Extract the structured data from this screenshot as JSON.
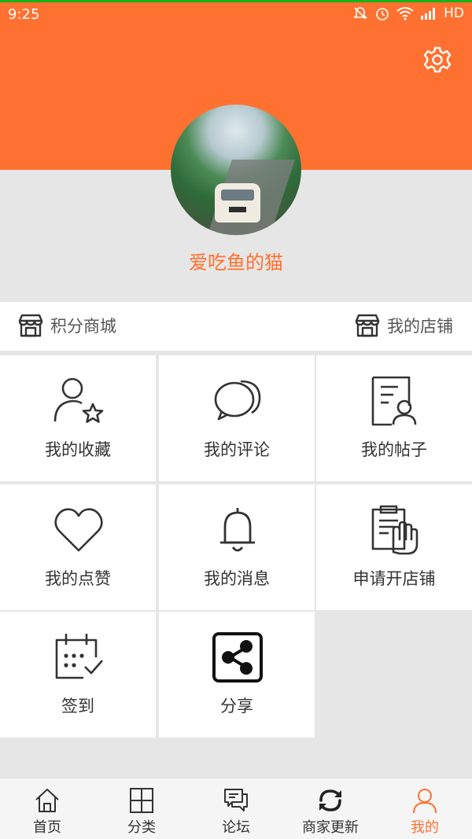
{
  "status_bar": {
    "time": "9:25",
    "network": "HD"
  },
  "profile": {
    "username": "爱吃鱼的猫"
  },
  "quick_links": {
    "points_mall": "积分商城",
    "my_shop": "我的店铺"
  },
  "menu": {
    "items": [
      {
        "label": "我的收藏",
        "icon": "user-star-icon"
      },
      {
        "label": "我的评论",
        "icon": "comment-bubbles-icon"
      },
      {
        "label": "我的帖子",
        "icon": "document-user-icon"
      },
      {
        "label": "我的点赞",
        "icon": "heart-icon"
      },
      {
        "label": "我的消息",
        "icon": "bell-icon"
      },
      {
        "label": "申请开店铺",
        "icon": "apply-hand-icon"
      },
      {
        "label": "签到",
        "icon": "calendar-check-icon"
      },
      {
        "label": "分享",
        "icon": "share-icon"
      }
    ]
  },
  "tabbar": {
    "tabs": [
      {
        "label": "首页",
        "icon": "home-icon"
      },
      {
        "label": "分类",
        "icon": "category-grid-icon"
      },
      {
        "label": "论坛",
        "icon": "forum-icon"
      },
      {
        "label": "商家更新",
        "icon": "refresh-icon"
      },
      {
        "label": "我的",
        "icon": "person-icon"
      }
    ],
    "active": "我的"
  },
  "colors": {
    "accent": "#ff7130",
    "background": "#e6e6e6",
    "card": "#ffffff"
  }
}
